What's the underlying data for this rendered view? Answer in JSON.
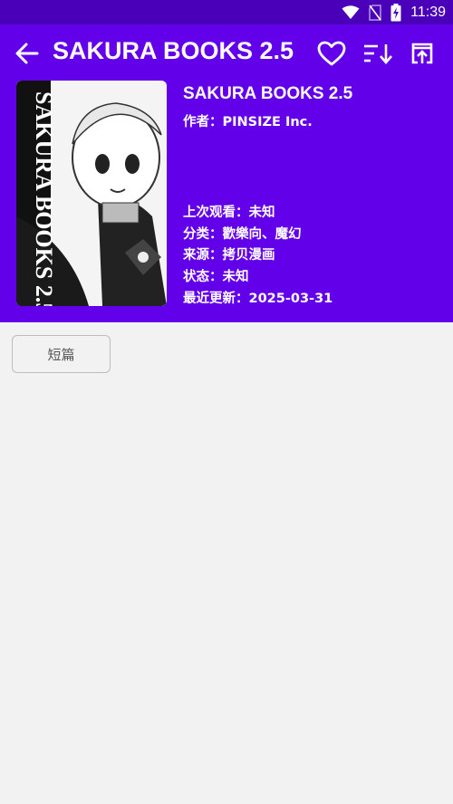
{
  "status_bar": {
    "time": "11:39",
    "icons": [
      "wifi-icon",
      "no-sim-icon",
      "battery-charging-icon"
    ]
  },
  "toolbar": {
    "title": "SAKURA BOOKS 2.5",
    "back_icon": "arrow-left-icon",
    "actions": [
      "heart-icon",
      "sort-icon",
      "open-external-icon"
    ]
  },
  "book": {
    "title": "SAKURA BOOKS 2.5",
    "author": "作者：PINSIZE Inc.",
    "cover_text": "SAKURA BOOKS 2.5",
    "last_viewed": "上次观看：未知",
    "category": "分类：歡樂向、魔幻",
    "source": "来源：拷贝漫画",
    "status": "状态：未知",
    "updated": "最近更新：2025-03-31"
  },
  "chapters": {
    "group_label": "短篇"
  },
  "colors": {
    "status_bar": "#4a00b8",
    "header": "#6200ea",
    "background": "#f2f2f2"
  }
}
